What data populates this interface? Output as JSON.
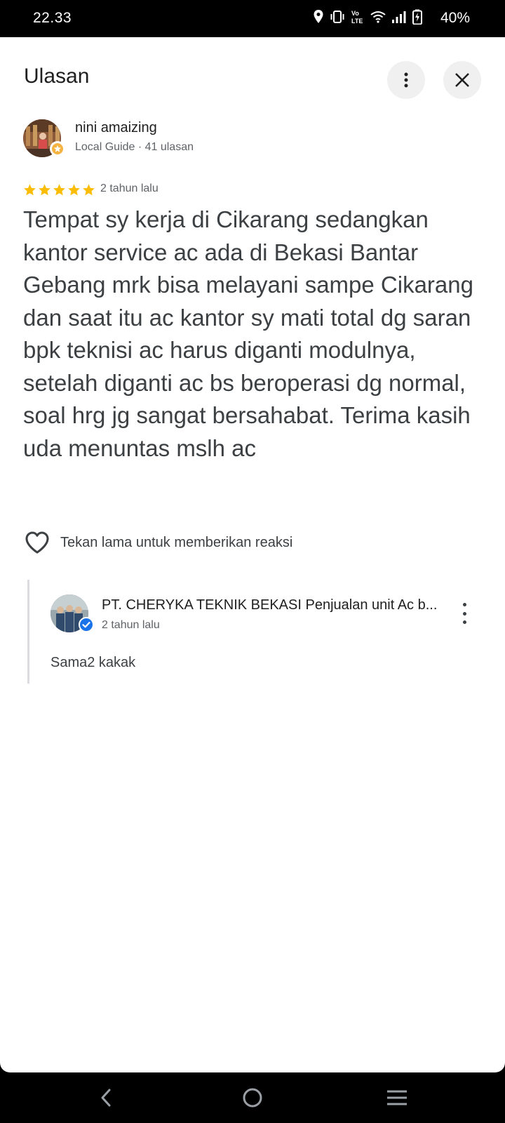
{
  "status_bar": {
    "time": "22.33",
    "battery_percent": "40%",
    "icons": [
      "location-icon",
      "vibrate-icon",
      "volte-icon",
      "wifi-icon",
      "signal-icon",
      "battery-charging-icon"
    ]
  },
  "header": {
    "title": "Ulasan",
    "more_icon": "more-vert-icon",
    "close_icon": "close-icon"
  },
  "review": {
    "author_name": "nini amaizing",
    "author_meta": "Local Guide · 41 ulasan",
    "rating": 5,
    "rating_max": 5,
    "date": "2 tahun lalu",
    "text": "Tempat sy kerja di Cikarang sedangkan kantor service ac ada di Bekasi Bantar Gebang mrk bisa melayani sampe Cikarang dan saat itu ac kantor sy mati total dg saran bpk teknisi ac harus diganti modulnya, setelah diganti ac bs beroperasi dg normal, soal hrg jg sangat bersahabat. Terima kasih uda menuntas mslh ac"
  },
  "reaction": {
    "label": "Tekan lama untuk memberikan reaksi",
    "icon": "heart-outline-icon"
  },
  "owner_reply": {
    "name": "PT. CHERYKA TEKNIK BEKASI Penjualan unit Ac b...",
    "date": "2 tahun lalu",
    "text": "Sama2 kakak",
    "badge_icon": "verified-icon"
  },
  "nav_bar": {
    "icons": [
      "back-icon",
      "home-icon",
      "recents-icon"
    ]
  },
  "colors": {
    "star": "#fbbc04",
    "verified": "#1a73e8",
    "text_primary": "#1f1f1f",
    "text_secondary": "#5f6368"
  }
}
